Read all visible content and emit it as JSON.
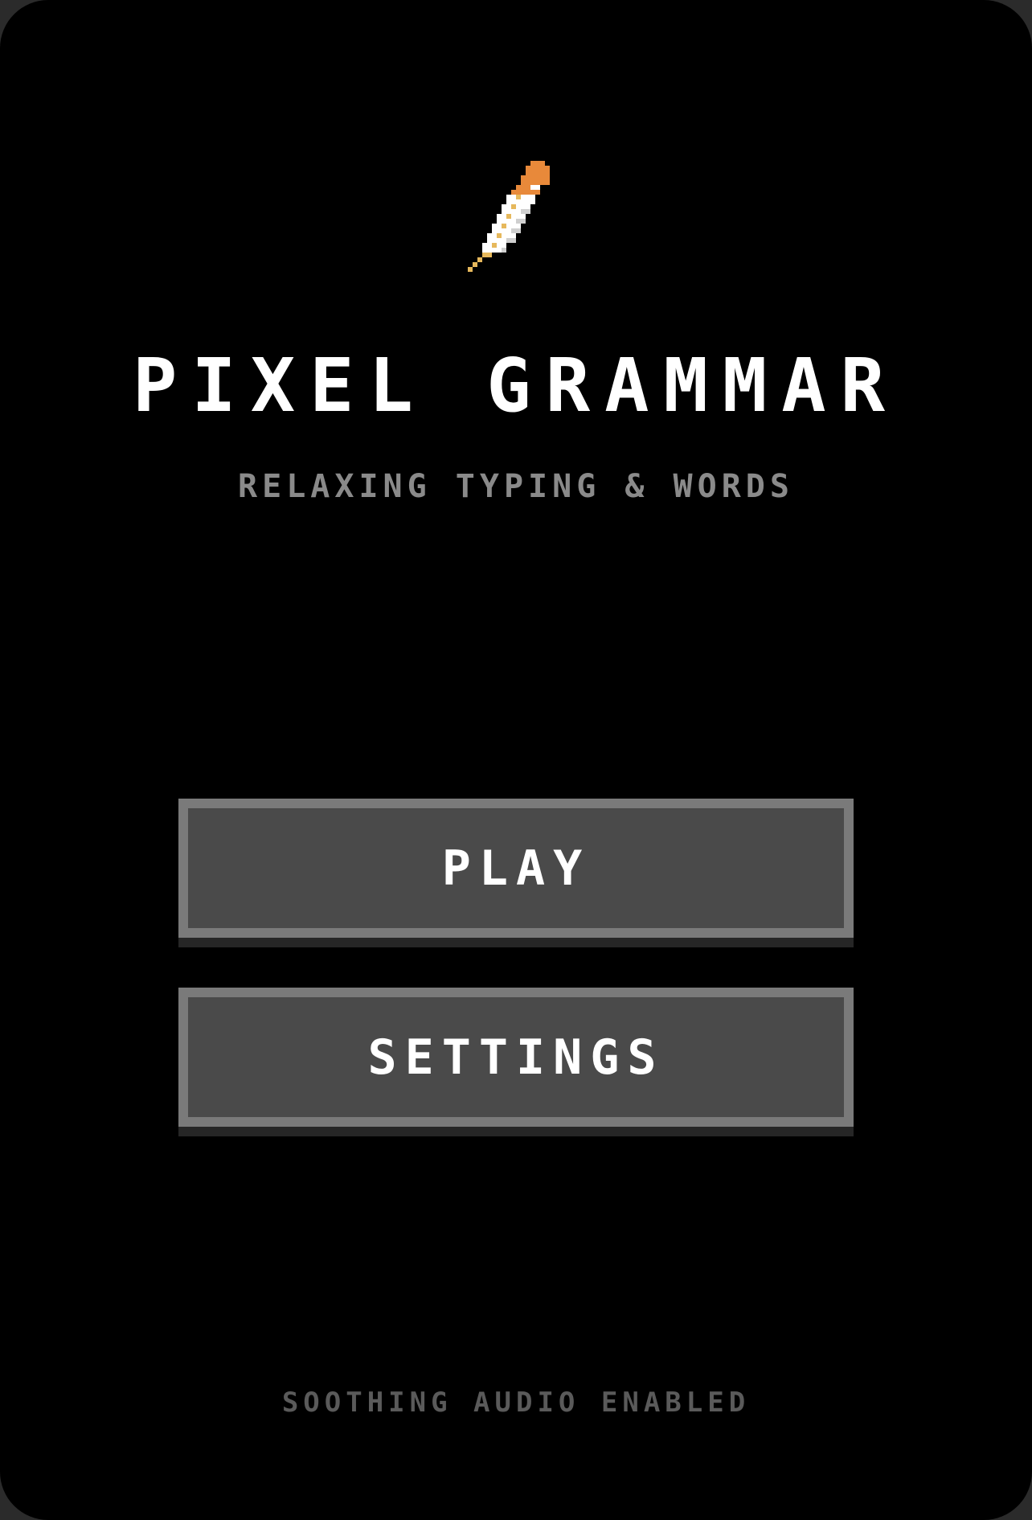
{
  "app": {
    "title": "PIXEL GRAMMAR",
    "subtitle": "RELAXING TYPING & WORDS",
    "logo_icon": "quill-feather-icon"
  },
  "menu": {
    "play_label": "PLAY",
    "settings_label": "SETTINGS"
  },
  "footer": {
    "status_text": "SOOTHING AUDIO ENABLED"
  },
  "colors": {
    "background": "#000000",
    "title": "#ffffff",
    "subtitle": "#8a8a8a",
    "button_fill": "#4a4a4a",
    "button_border": "#7a7a7a",
    "footer_text": "#5a5a5a",
    "feather_orange": "#e8893a",
    "feather_white": "#ffffff",
    "feather_shaft": "#e6b85c"
  }
}
